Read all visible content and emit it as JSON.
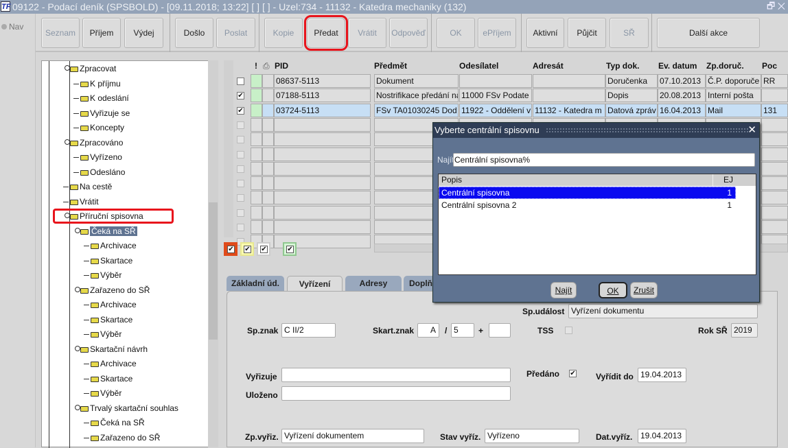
{
  "window": {
    "title": "09122 - Podací deník (SPSBOLD) - [09.11.2018; 13:22]  [ ]  [ ] - Uzel:734 - 11132 - Katedra mechaniky (132)",
    "app_icon": "TF",
    "controls": "🗗 ✕",
    "nav": "Nav"
  },
  "toolbar": {
    "buttons": [
      {
        "label": "Seznam",
        "enabled": false
      },
      {
        "label": "Příjem",
        "enabled": true
      },
      {
        "label": "Výdej",
        "enabled": true
      },
      {
        "label": "Došlo",
        "enabled": true
      },
      {
        "label": "Poslat",
        "enabled": false
      },
      {
        "label": "Kopie",
        "enabled": false
      },
      {
        "label": "Předat",
        "enabled": true,
        "highlighted": true
      },
      {
        "label": "Vrátit",
        "enabled": false
      },
      {
        "label": "Odpověď",
        "enabled": false
      },
      {
        "label": "OK",
        "enabled": false
      },
      {
        "label": "ePříjem",
        "enabled": false
      },
      {
        "label": "Aktivní",
        "enabled": true
      },
      {
        "label": "Půjčit",
        "enabled": true
      },
      {
        "label": "SŘ",
        "enabled": false
      },
      {
        "label": "Další akce",
        "enabled": true
      }
    ]
  },
  "tree": {
    "items": [
      {
        "label": "Zpracovat",
        "level": 0,
        "expander": true
      },
      {
        "label": "K příjmu",
        "level": 1
      },
      {
        "label": "K odeslání",
        "level": 1
      },
      {
        "label": "Vyřizuje se",
        "level": 1
      },
      {
        "label": "Koncepty",
        "level": 1
      },
      {
        "label": "Zpracováno",
        "level": 0,
        "expander": true
      },
      {
        "label": "Vyřízeno",
        "level": 1
      },
      {
        "label": "Odesláno",
        "level": 1
      },
      {
        "label": "Na cestě",
        "level": 0
      },
      {
        "label": "Vrátit",
        "level": 0
      },
      {
        "label": "Příruční spisovna",
        "level": 0,
        "expander": true,
        "highlighted": true
      },
      {
        "label": "Čeká na SŘ",
        "level": 1,
        "expander": true,
        "selected": true
      },
      {
        "label": "Archivace",
        "level": 2
      },
      {
        "label": "Skartace",
        "level": 2
      },
      {
        "label": "Výběr",
        "level": 2
      },
      {
        "label": "Zařazeno do SŘ",
        "level": 1,
        "expander": true
      },
      {
        "label": "Archivace",
        "level": 2
      },
      {
        "label": "Skartace",
        "level": 2
      },
      {
        "label": "Výběr",
        "level": 2
      },
      {
        "label": "Skartační návrh",
        "level": 1,
        "expander": true
      },
      {
        "label": "Archivace",
        "level": 2
      },
      {
        "label": "Skartace",
        "level": 2
      },
      {
        "label": "Výběr",
        "level": 2
      },
      {
        "label": "Trvalý skartační souhlas",
        "level": 1,
        "expander": true
      },
      {
        "label": "Čeká na SŘ",
        "level": 2
      },
      {
        "label": "Zařazeno do SŘ",
        "level": 2
      }
    ]
  },
  "grid": {
    "headers": {
      "priority": "!",
      "pid": "PID",
      "predmet": "Předmět",
      "odesilatel": "Odesílatel",
      "adresat": "Adresát",
      "typ": "Typ dok.",
      "ev_datum": "Ev. datum",
      "zp_doruc": "Zp.doruč.",
      "poc": "Poc"
    },
    "rows": [
      {
        "checked": false,
        "pid": "08637-5113",
        "predmet": "Dokument",
        "odesilatel": "",
        "adresat": "",
        "typ": "Doručenka",
        "ev_datum": "07.10.2013",
        "zp_doruc": "Č.P. doporuče",
        "poc": "RR"
      },
      {
        "checked": true,
        "pid": "07188-5113",
        "predmet": "Nostrifikace předání na",
        "odesilatel": "11000 FSv Podate",
        "adresat": "",
        "typ": "Dopis",
        "ev_datum": "20.08.2013",
        "zp_doruc": "Interní pošta",
        "poc": ""
      },
      {
        "checked": true,
        "selected": true,
        "pid": "03724-5113",
        "predmet": "FSv TA01030245 Dod",
        "odesilatel": "11922 - Oddělení v",
        "adresat": "11132 - Katedra m",
        "typ": "Datová zpráv",
        "ev_datum": "16.04.2013",
        "zp_doruc": "Mail",
        "poc": "131"
      }
    ],
    "empty_rows": 9,
    "color_filters": [
      {
        "border": "#e04a1a",
        "bg": "#e04a1a"
      },
      {
        "border": "#e8e890",
        "bg": "#fbfbb0"
      },
      {
        "border": "#cccccc",
        "bg": "#ffffff"
      },
      {
        "border": "#90c890",
        "bg": "#d6f5d6"
      }
    ]
  },
  "tabs": [
    {
      "label": "Základní úd."
    },
    {
      "label": "Vyřízení",
      "active": true
    },
    {
      "label": "Adresy"
    },
    {
      "label": "Doplň"
    }
  ],
  "form": {
    "sp_udalost_label": "Sp.událost",
    "sp_udalost": "Vyřízení dokumentu",
    "sp_znak_label": "Sp.znak",
    "sp_znak": "C II/2",
    "skart_znak_label": "Skart.znak",
    "skart_znak": "A",
    "slash": "/",
    "skart_lhuta": "5",
    "plus": "+",
    "skart_extra": "",
    "tss_label": "TSS",
    "rok_sr_label": "Rok SŘ",
    "rok_sr": "2019",
    "vyrizuje_label": "Vyřizuje",
    "vyrizuje": "",
    "predano_label": "Předáno",
    "vyridit_do_label": "Vyřídit do",
    "vyridit_do": "19.04.2013",
    "ulozeno_label": "Uloženo",
    "ulozeno": "",
    "zp_vyriz_label": "Zp.vyřiz.",
    "zp_vyriz": "Vyřízení dokumentem",
    "stav_vyriz_label": "Stav vyříz.",
    "stav_vyriz": "Vyřízeno",
    "dat_vyriz_label": "Dat.vyříz.",
    "dat_vyriz": "19.04.2013"
  },
  "dialog": {
    "title": "Vyberte centrální spisovnu",
    "close": "✕",
    "find_label": "Najít",
    "find_value": "Centrální spisovna%",
    "col_popis": "Popis",
    "col_ej": "EJ",
    "rows": [
      {
        "popis": "Centrální spisovna",
        "ej": "1",
        "selected": true
      },
      {
        "popis": "Centrální spisovna 2",
        "ej": "1"
      }
    ],
    "btn_find": "Najít",
    "btn_ok": "OK",
    "btn_cancel": "Zrušit"
  }
}
